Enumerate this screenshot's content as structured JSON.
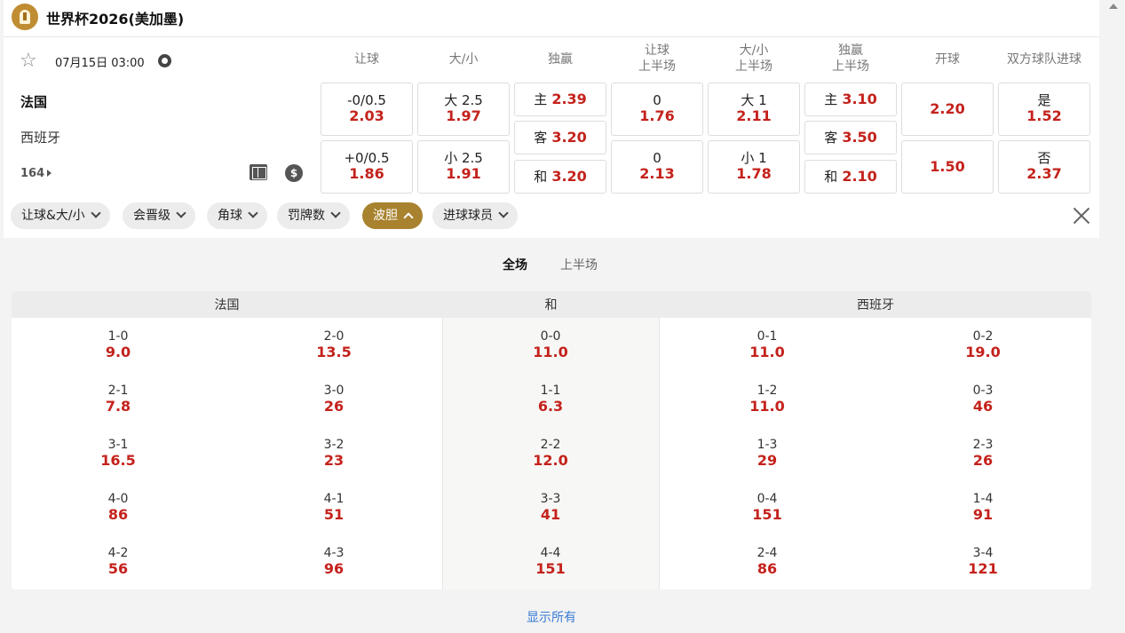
{
  "league": {
    "title": "世界杯2026(美加墨)"
  },
  "match": {
    "time": "07月15日 03:00",
    "home_team": "法国",
    "away_team": "西班牙",
    "more_markets_count": "164"
  },
  "columns": {
    "handicap": "让球",
    "over_under": "大/小",
    "moneyline": "独赢",
    "handicap_half_l1": "让球",
    "handicap_half_l2": "上半场",
    "ou_half_l1": "大/小",
    "ou_half_l2": "上半场",
    "moneyline_half_l1": "独赢",
    "moneyline_half_l2": "上半场",
    "kickoff": "开球",
    "btts": "双方球队进球"
  },
  "odds": {
    "handicap": [
      {
        "label": "-0/0.5",
        "value": "2.03"
      },
      {
        "label": "+0/0.5",
        "value": "1.86"
      }
    ],
    "over_under": [
      {
        "label": "大 2.5",
        "value": "1.97"
      },
      {
        "label": "小 2.5",
        "value": "1.91"
      }
    ],
    "moneyline": [
      {
        "label": "主",
        "value": "2.39"
      },
      {
        "label": "客",
        "value": "3.20"
      },
      {
        "label": "和",
        "value": "3.20"
      }
    ],
    "handicap_half": [
      {
        "label": "0",
        "value": "1.76"
      },
      {
        "label": "0",
        "value": "2.13"
      }
    ],
    "ou_half": [
      {
        "label": "大 1",
        "value": "2.11"
      },
      {
        "label": "小 1",
        "value": "1.78"
      }
    ],
    "moneyline_half": [
      {
        "label": "主",
        "value": "3.10"
      },
      {
        "label": "客",
        "value": "3.50"
      },
      {
        "label": "和",
        "value": "2.10"
      }
    ],
    "kickoff": [
      {
        "value": "2.20"
      },
      {
        "value": "1.50"
      }
    ],
    "btts": [
      {
        "label": "是",
        "value": "1.52"
      },
      {
        "label": "否",
        "value": "2.37"
      }
    ]
  },
  "filters": [
    {
      "label": "让球&大/小"
    },
    {
      "label": "会晋级"
    },
    {
      "label": "角球"
    },
    {
      "label": "罚牌数"
    },
    {
      "label": "波胆"
    },
    {
      "label": "进球球员"
    }
  ],
  "tabs": {
    "full": "全场",
    "half": "上半场"
  },
  "correct_score": {
    "home_header": "法国",
    "draw_header": "和",
    "away_header": "西班牙",
    "home_a": [
      {
        "s": "1-0",
        "p": "9.0"
      },
      {
        "s": "2-1",
        "p": "7.8"
      },
      {
        "s": "3-1",
        "p": "16.5"
      },
      {
        "s": "4-0",
        "p": "86"
      },
      {
        "s": "4-2",
        "p": "56"
      }
    ],
    "home_b": [
      {
        "s": "2-0",
        "p": "13.5"
      },
      {
        "s": "3-0",
        "p": "26"
      },
      {
        "s": "3-2",
        "p": "23"
      },
      {
        "s": "4-1",
        "p": "51"
      },
      {
        "s": "4-3",
        "p": "96"
      }
    ],
    "draw": [
      {
        "s": "0-0",
        "p": "11.0"
      },
      {
        "s": "1-1",
        "p": "6.3"
      },
      {
        "s": "2-2",
        "p": "12.0"
      },
      {
        "s": "3-3",
        "p": "41"
      },
      {
        "s": "4-4",
        "p": "151"
      }
    ],
    "away_a": [
      {
        "s": "0-1",
        "p": "11.0"
      },
      {
        "s": "1-2",
        "p": "11.0"
      },
      {
        "s": "1-3",
        "p": "29"
      },
      {
        "s": "0-4",
        "p": "151"
      },
      {
        "s": "2-4",
        "p": "86"
      }
    ],
    "away_b": [
      {
        "s": "0-2",
        "p": "19.0"
      },
      {
        "s": "0-3",
        "p": "46"
      },
      {
        "s": "2-3",
        "p": "26"
      },
      {
        "s": "1-4",
        "p": "91"
      },
      {
        "s": "3-4",
        "p": "121"
      }
    ]
  },
  "show_all": "显示所有",
  "icons": {
    "logo": "trophy-logo-icon",
    "star": "star-icon",
    "clock": "clock-icon",
    "field": "pitch-icon",
    "dollar": "dollar-icon",
    "close": "close-icon"
  },
  "colors": {
    "accent": "#a8822e",
    "odds": "#c4221c",
    "link": "#3a7bd5"
  }
}
